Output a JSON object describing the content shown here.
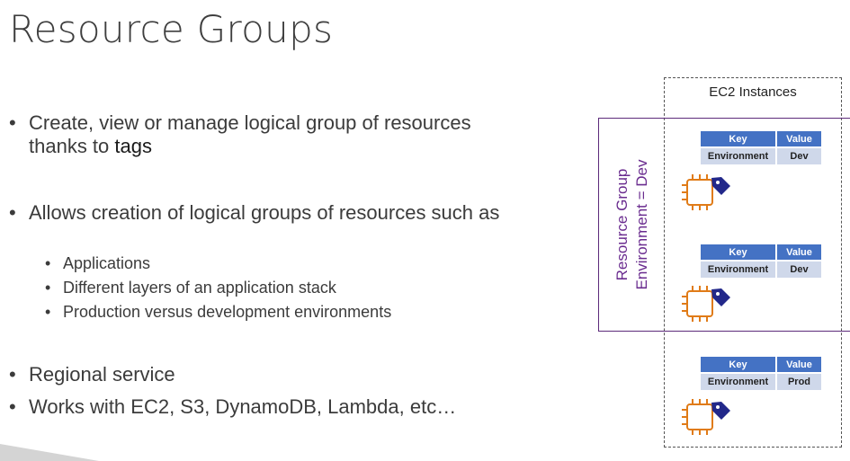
{
  "slide": {
    "title": "Resource Groups",
    "bullets": [
      {
        "text": "Create, view or manage logical group of resources thanks to ",
        "emphasis": "tags"
      },
      {
        "text": "Allows creation of logical groups of resources such as"
      },
      {
        "text": "Regional service"
      },
      {
        "text": "Works with EC2, S3, DynamoDB, Lambda, etc…"
      }
    ],
    "sub_bullets": [
      "Applications",
      "Different layers of an application stack",
      "Production versus development environments"
    ]
  },
  "diagram": {
    "ec2_box_title": "EC2 Instances",
    "resource_group_label": [
      "Resource Group",
      "Environment = Dev"
    ],
    "tables": [
      {
        "header": [
          "Key",
          "Value"
        ],
        "row": [
          "Environment",
          "Dev"
        ]
      },
      {
        "header": [
          "Key",
          "Value"
        ],
        "row": [
          "Environment",
          "Dev"
        ]
      },
      {
        "header": [
          "Key",
          "Value"
        ],
        "row": [
          "Environment",
          "Prod"
        ]
      }
    ],
    "colors": {
      "header_blue": "#4472c4",
      "cell_blue": "#cfd8ea",
      "group_purple": "#6a2c8f",
      "chip_orange": "#e07b17",
      "tag_navy": "#22288a"
    },
    "icons": [
      "ec2-instance-chip-icon",
      "tag-icon"
    ]
  }
}
